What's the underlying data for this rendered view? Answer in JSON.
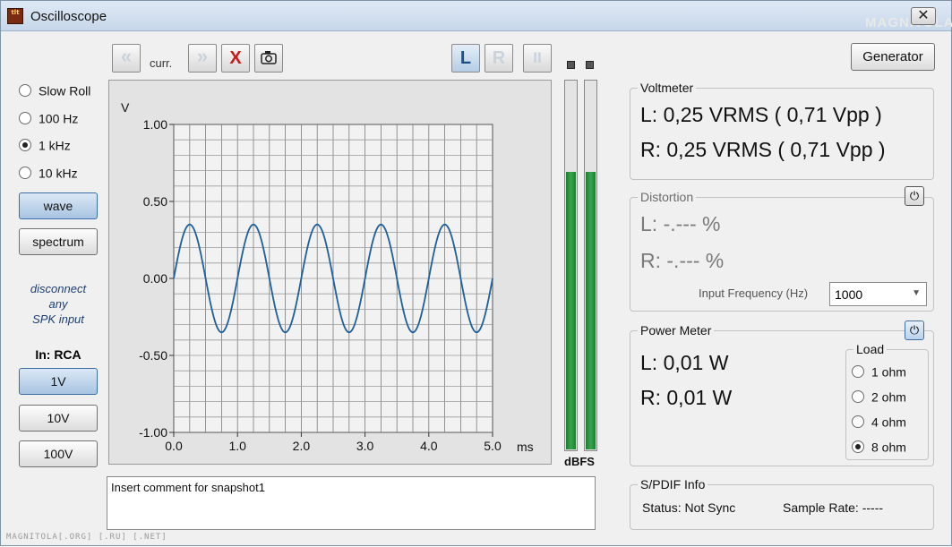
{
  "window": {
    "title": "Oscilloscope",
    "close_label": "✕",
    "app_icon_text": "tlt",
    "watermark_top": "MAGNITOLA",
    "watermark_bottom": "MAGNITOLA[.ORG] [.RU] [.NET]"
  },
  "toolbar": {
    "prev_label": "«",
    "curr_label": "curr.",
    "next_label": "»",
    "delete_label": "X",
    "snapshot_icon": "camera-icon",
    "left_label": "L",
    "right_label": "R",
    "pause_label": "II"
  },
  "left_panel": {
    "timebase_options": [
      {
        "label": "Slow Roll",
        "checked": false
      },
      {
        "label": "100 Hz",
        "checked": false
      },
      {
        "label": "1 kHz",
        "checked": true
      },
      {
        "label": "10 kHz",
        "checked": false
      }
    ],
    "wave_label": "wave",
    "spectrum_label": "spectrum",
    "note_lines": [
      "disconnect",
      "any",
      "SPK input"
    ],
    "input_label": "In: RCA",
    "ranges": [
      {
        "label": "1V",
        "active": true
      },
      {
        "label": "10V",
        "active": false
      },
      {
        "label": "100V",
        "active": false
      }
    ]
  },
  "chart_data": {
    "type": "line",
    "title": "",
    "xlabel": "ms",
    "ylabel": "V",
    "xlim": [
      0,
      5.0
    ],
    "ylim": [
      -1.0,
      1.0
    ],
    "x_ticks": [
      "0.0",
      "1.0",
      "2.0",
      "3.0",
      "4.0",
      "5.0"
    ],
    "y_ticks": [
      "1.00",
      "0.50",
      "0.00",
      "-0.50",
      "-1.00"
    ],
    "grid": true,
    "series": [
      {
        "name": "",
        "waveform": "sine",
        "frequency_khz": 1.0,
        "amplitude_v": 0.35,
        "x": [
          0.0,
          0.25,
          0.5,
          0.75,
          1.0,
          1.25,
          1.5,
          1.75,
          2.0,
          2.25,
          2.5,
          2.75,
          3.0,
          3.25,
          3.5,
          3.75,
          4.0,
          4.25,
          4.5,
          4.75,
          5.0
        ],
        "y": [
          0.0,
          0.35,
          0.0,
          -0.35,
          0.0,
          0.35,
          0.0,
          -0.35,
          0.0,
          0.35,
          0.0,
          -0.35,
          0.0,
          0.35,
          0.0,
          -0.35,
          0.0,
          0.35,
          0.0,
          -0.35,
          0.0
        ]
      }
    ],
    "color": "#1f5f9c"
  },
  "level_meters": {
    "label": "dBFS",
    "left_level": 0.75,
    "right_level": 0.75,
    "color": "#2e9b45"
  },
  "comment": {
    "text": "Insert comment for snapshot1"
  },
  "generator_label": "Generator",
  "voltmeter": {
    "title": "Voltmeter",
    "left": "L: 0,25 VRMS ( 0,71 Vpp )",
    "right": "R: 0,25 VRMS ( 0,71 Vpp )"
  },
  "distortion": {
    "title": "Distortion",
    "left": "L: -.--- %",
    "right": "R: -.--- %",
    "input_freq_label": "Input Frequency (Hz)",
    "input_freq_value": "1000"
  },
  "power_meter": {
    "title": "Power Meter",
    "left": "L: 0,01 W",
    "right": "R: 0,01 W",
    "load_title": "Load",
    "load_options": [
      {
        "label": "1 ohm",
        "checked": false
      },
      {
        "label": "2 ohm",
        "checked": false
      },
      {
        "label": "4 ohm",
        "checked": false
      },
      {
        "label": "8 ohm",
        "checked": true
      }
    ]
  },
  "spdif": {
    "title": "S/PDIF Info",
    "status": "Status: Not Sync",
    "sample_rate": "Sample Rate: -----"
  }
}
